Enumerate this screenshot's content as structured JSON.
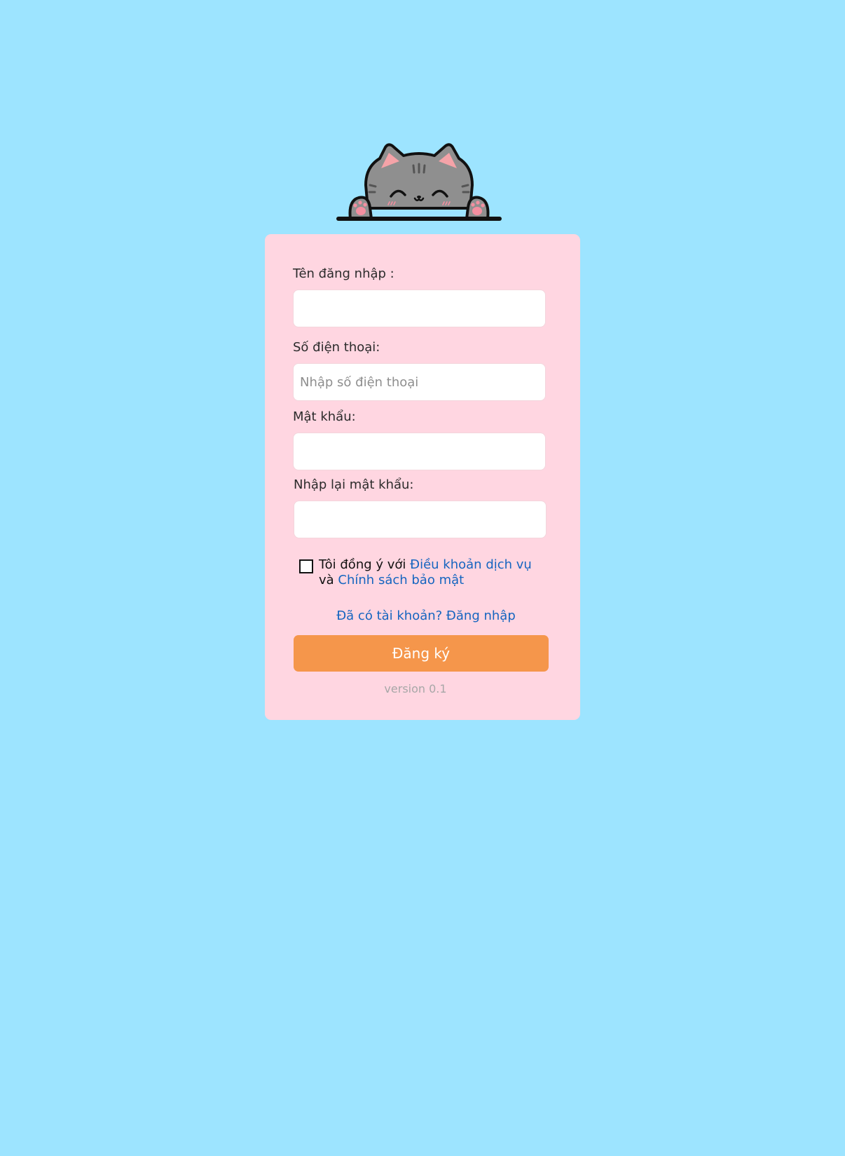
{
  "mascot": {
    "icon": "peeking-cat-icon",
    "colors": {
      "fur": "#8f8f8f",
      "ear_inner": "#f5a3a8",
      "paw_pad": "#f48fa0",
      "outline": "#111111"
    }
  },
  "form": {
    "username_label": "Tên đăng nhập :",
    "username_placeholder": "",
    "phone_label": "Số điện thoại:",
    "phone_placeholder": "Nhập số điện thoại",
    "password_label": "Mật khẩu:",
    "password_placeholder": "",
    "confirm_password_label": "Nhập lại mật khẩu:",
    "confirm_password_placeholder": "",
    "agree_prefix": "Tôi đồng ý với",
    "terms_link": "Điều khoản dịch vụ",
    "agree_and": "và",
    "privacy_link": "Chính sách bảo mật",
    "agree_checked": false,
    "login_link": "Đã có tài khoản? Đăng nhập",
    "submit_label": "Đăng ký",
    "version": "version 0.1"
  },
  "colors": {
    "background": "#9de4ff",
    "card": "#ffd6e1",
    "button": "#f5964b",
    "link": "#1565c0",
    "version_text": "#a7a7a7"
  }
}
